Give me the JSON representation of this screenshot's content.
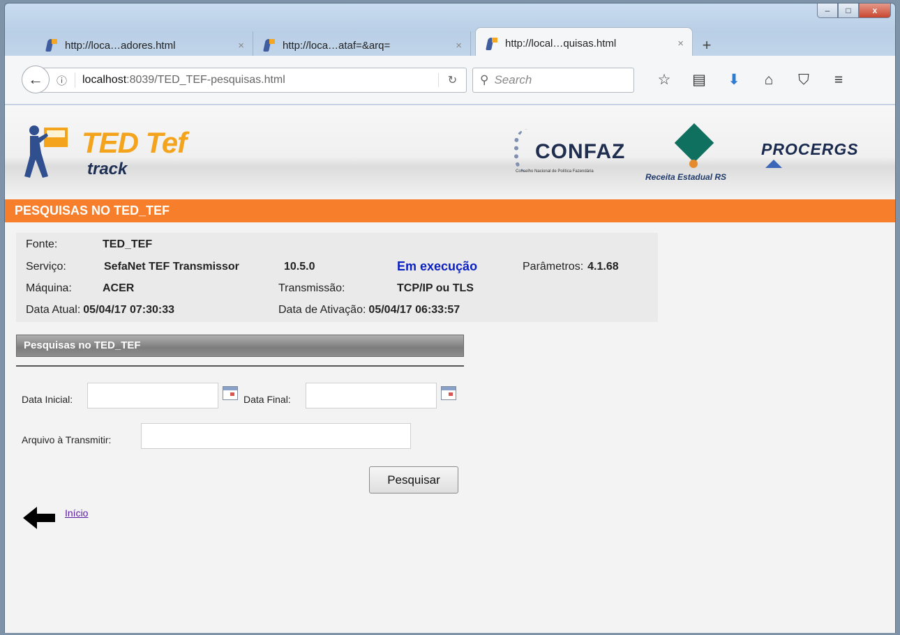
{
  "window": {
    "minimize_glyph": "–",
    "maximize_glyph": "□",
    "close_glyph": "x"
  },
  "tabs": [
    {
      "title": "http://loca…adores.html",
      "close": "×",
      "active": false
    },
    {
      "title": "http://loca…ataf=&arq=",
      "close": "×",
      "active": false
    },
    {
      "title": "http://local…quisas.html",
      "close": "×",
      "active": true
    }
  ],
  "newtab_glyph": "+",
  "nav": {
    "back_glyph": "←",
    "info_glyph": "ⓘ",
    "url_host": "localhost",
    "url_rest": ":8039/TED_TEF-pesquisas.html",
    "reload_glyph": "↻",
    "search_placeholder": "Search",
    "search_glyph": "⚲",
    "icons": [
      "star-icon",
      "reading-list-icon",
      "download-icon",
      "home-icon",
      "pocket-icon",
      "menu-icon"
    ],
    "icon_glyphs": [
      "☆",
      "▤",
      "⬇",
      "⌂",
      "⛉",
      "≡"
    ]
  },
  "banner": {
    "ted_title": "TED Tef",
    "ted_sub": "track",
    "confaz": "CONFAZ",
    "confaz_sub": "Conselho Nacional de Política Fazendária",
    "receita": "Receita Estadual RS",
    "procergs": "PROCERGS"
  },
  "page_title": "PESQUISAS NO TED_TEF",
  "info": {
    "fonte_label": "Fonte:",
    "fonte_value": "TED_TEF",
    "servico_label": "Serviço:",
    "servico_value": "SefaNet TEF Transmissor",
    "versao_value": "10.5.0",
    "status": "Em execução",
    "parametros_label": "Parâmetros:",
    "parametros_value": "4.1.68",
    "maquina_label": "Máquina:",
    "maquina_value": "ACER",
    "transmissao_label": "Transmissão:",
    "transmissao_value": "TCP/IP ou TLS",
    "data_atual_label": "Data Atual:",
    "data_atual_value": "05/04/17 07:30:33",
    "data_ativacao_label": "Data de Ativação:",
    "data_ativacao_value": "05/04/17 06:33:57",
    "status_color": "#0a1fc2"
  },
  "section_title": "Pesquisas no TED_TEF",
  "form": {
    "data_inicial_label": "Data Inicial:",
    "data_inicial_value": "",
    "data_final_label": "Data Final:",
    "data_final_value": "",
    "arquivo_label": "Arquivo à Transmitir:",
    "arquivo_value": "",
    "search_button": "Pesquisar"
  },
  "back_link": "Início",
  "colors": {
    "accent_orange": "#f77f2b",
    "link_purple": "#5a1aa0"
  }
}
